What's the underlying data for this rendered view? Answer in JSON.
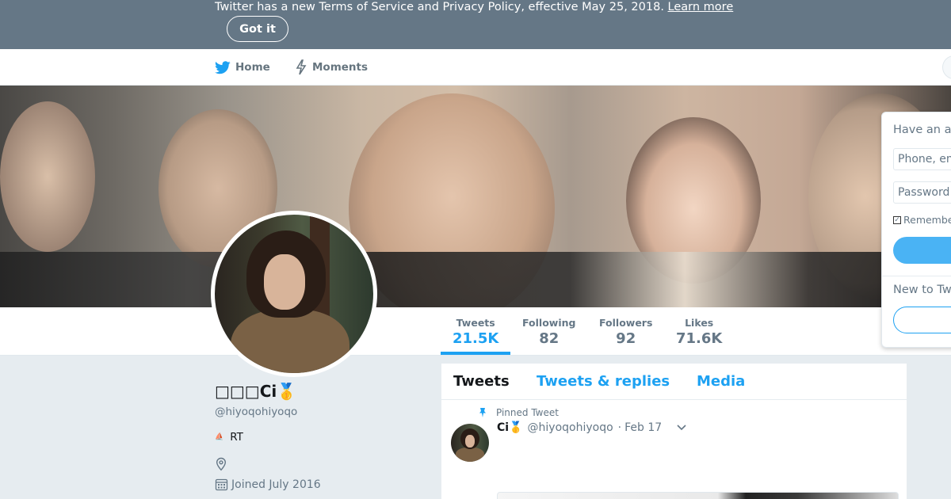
{
  "notice": {
    "text": "Twitter has a new Terms of Service and Privacy Policy, effective May 25, 2018.",
    "learn_more": "Learn more",
    "got_it": "Got it"
  },
  "nav": {
    "home": "Home",
    "moments": "Moments"
  },
  "stats": [
    {
      "label": "Tweets",
      "value": "21.5K"
    },
    {
      "label": "Following",
      "value": "82"
    },
    {
      "label": "Followers",
      "value": "92"
    },
    {
      "label": "Likes",
      "value": "71.6K"
    }
  ],
  "profile": {
    "name": "□□□Ci🥇",
    "handle": "@hiyoqohiyoqo",
    "bio": "RT",
    "joined": "Joined July 2016"
  },
  "timeline": {
    "tabs": [
      "Tweets",
      "Tweets & replies",
      "Media"
    ],
    "pinned_label": "Pinned Tweet",
    "tweet": {
      "name": "Ci🥇",
      "handle": "@hiyoqohiyoqo",
      "separator": "·",
      "time": "Feb 17"
    }
  },
  "login": {
    "title": "Have an account?",
    "username_placeholder": "Phone, email or username",
    "password_placeholder": "Password",
    "remember": "Remember me",
    "new_to_twitter": "New to Twitter?"
  },
  "colors": {
    "accent": "#1da1f2",
    "banner_bg": "#657786",
    "page_bg": "#e6ecf0"
  }
}
